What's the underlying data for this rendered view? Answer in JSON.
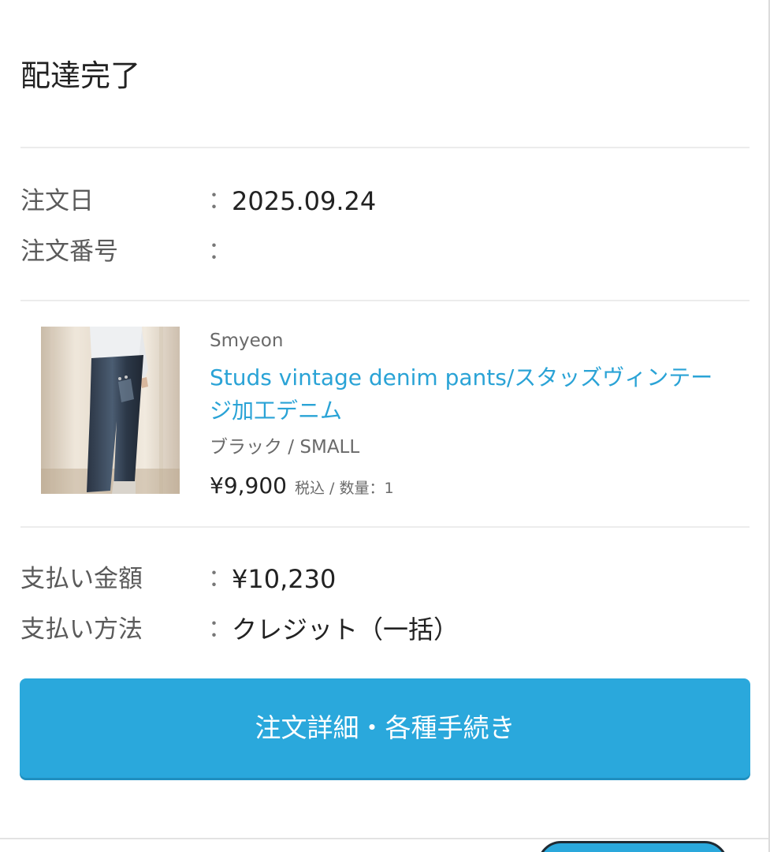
{
  "order": {
    "status": "配達完了",
    "date_label": "注文日",
    "date_colon": "：",
    "date_value": "2025.09.24",
    "number_label": "注文番号",
    "number_colon": "："
  },
  "product": {
    "image_name": "denim-pants-photo",
    "brand": "Smyeon",
    "name": "Studs vintage denim pants/スタッズヴィンテージ加工デニム",
    "variant": "ブラック / SMALL",
    "price": "¥9,900",
    "price_meta": "税込 / 数量：1"
  },
  "payment": {
    "amount_label": "支払い金額",
    "amount_colon": "：",
    "amount_value": "¥10,230",
    "method_label": "支払い方法",
    "method_colon": "：",
    "method_value": "クレジット（一括）"
  },
  "actions": {
    "details_button": "注文詳細・各種手続き"
  },
  "colors": {
    "accent": "#2aa8dc",
    "link": "#2aa3d6",
    "text": "#222222",
    "muted": "#6a6a6a"
  }
}
